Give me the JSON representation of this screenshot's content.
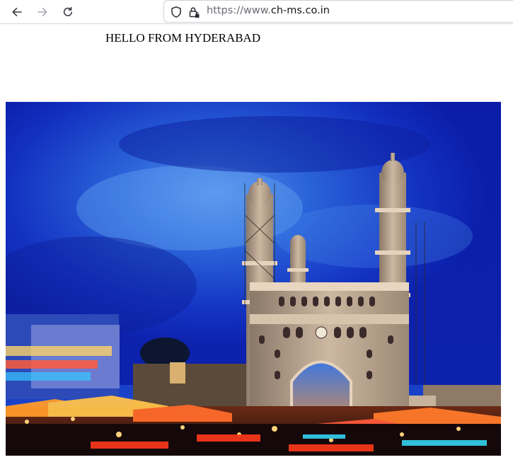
{
  "browser": {
    "url_scheme": "https://www.",
    "url_domain": "ch-ms.co.in",
    "back_icon": "back-arrow-icon",
    "forward_icon": "forward-arrow-icon",
    "reload_icon": "reload-icon",
    "shield_icon": "tracking-protection-shield-icon",
    "lock_icon": "secure-lock-icon"
  },
  "page": {
    "heading": "HELLO FROM HYDERABAD",
    "image_subject": "Charminar monument at night with illuminated market"
  },
  "colors": {
    "sky_deep": "#0a1fae",
    "sky_light": "#3a7be8",
    "monument": "#b9a48f",
    "lights_warm": "#ff8a1e"
  }
}
